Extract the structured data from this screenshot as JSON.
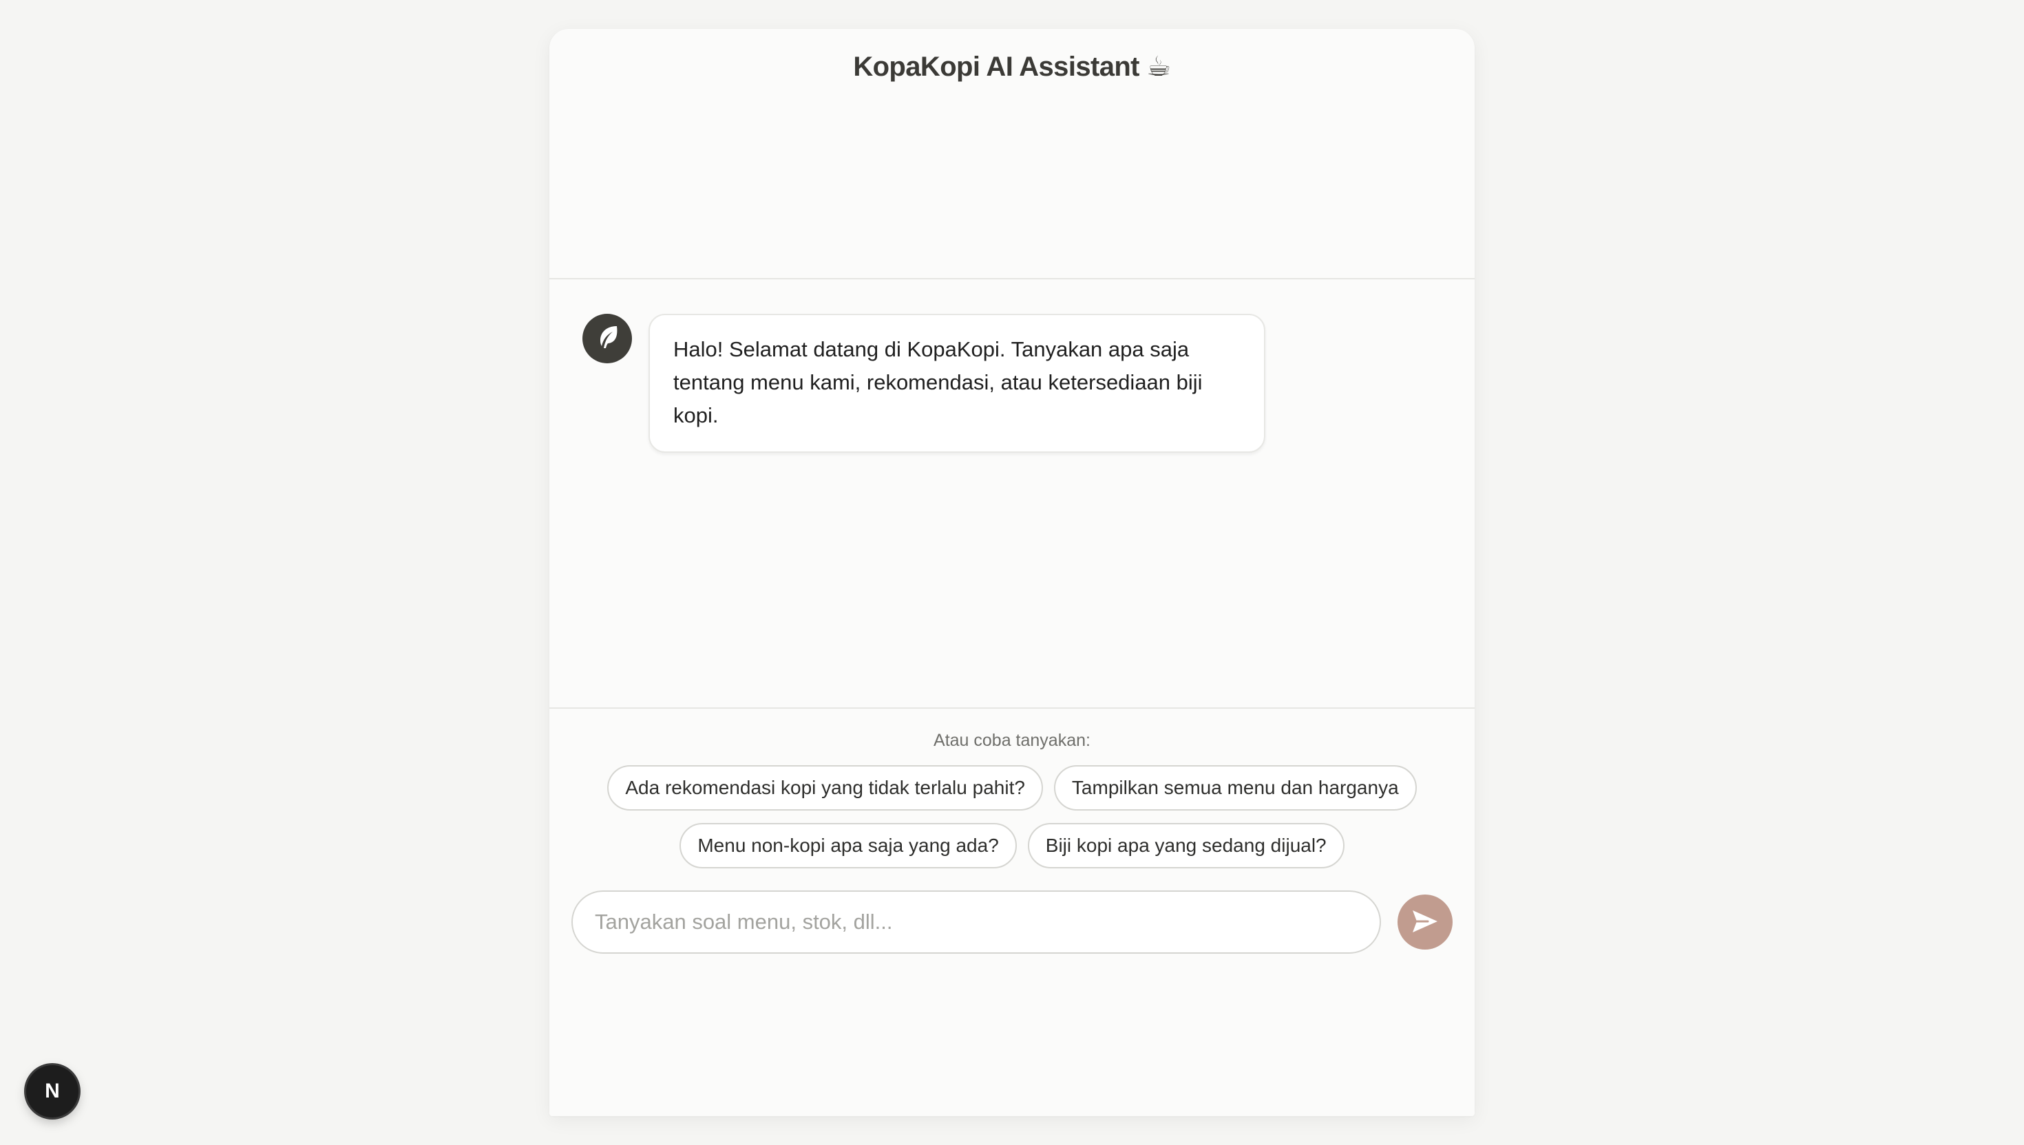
{
  "header": {
    "title": "KopaKopi AI Assistant ☕"
  },
  "messages": [
    {
      "role": "assistant",
      "avatar_icon": "leaf-icon",
      "text": "Halo! Selamat datang di KopaKopi. Tanyakan apa saja tentang menu kami, rekomendasi, atau ketersediaan biji kopi."
    }
  ],
  "suggestions": {
    "label": "Atau coba tanyakan:",
    "items": [
      "Ada rekomendasi kopi yang tidak terlalu pahit?",
      "Tampilkan semua menu dan harganya",
      "Menu non-kopi apa saja yang ada?",
      "Biji kopi apa yang sedang dijual?"
    ]
  },
  "composer": {
    "placeholder": "Tanyakan soal menu, stok, dll...",
    "value": "",
    "send_icon": "send-icon"
  },
  "dev_indicator": {
    "label": "N"
  },
  "colors": {
    "page_bg": "#f5f5f3",
    "card_bg": "#fbfbfa",
    "avatar_bg": "#3f3e39",
    "send_button": "#c19c8f",
    "divider": "#e6e6e3"
  }
}
